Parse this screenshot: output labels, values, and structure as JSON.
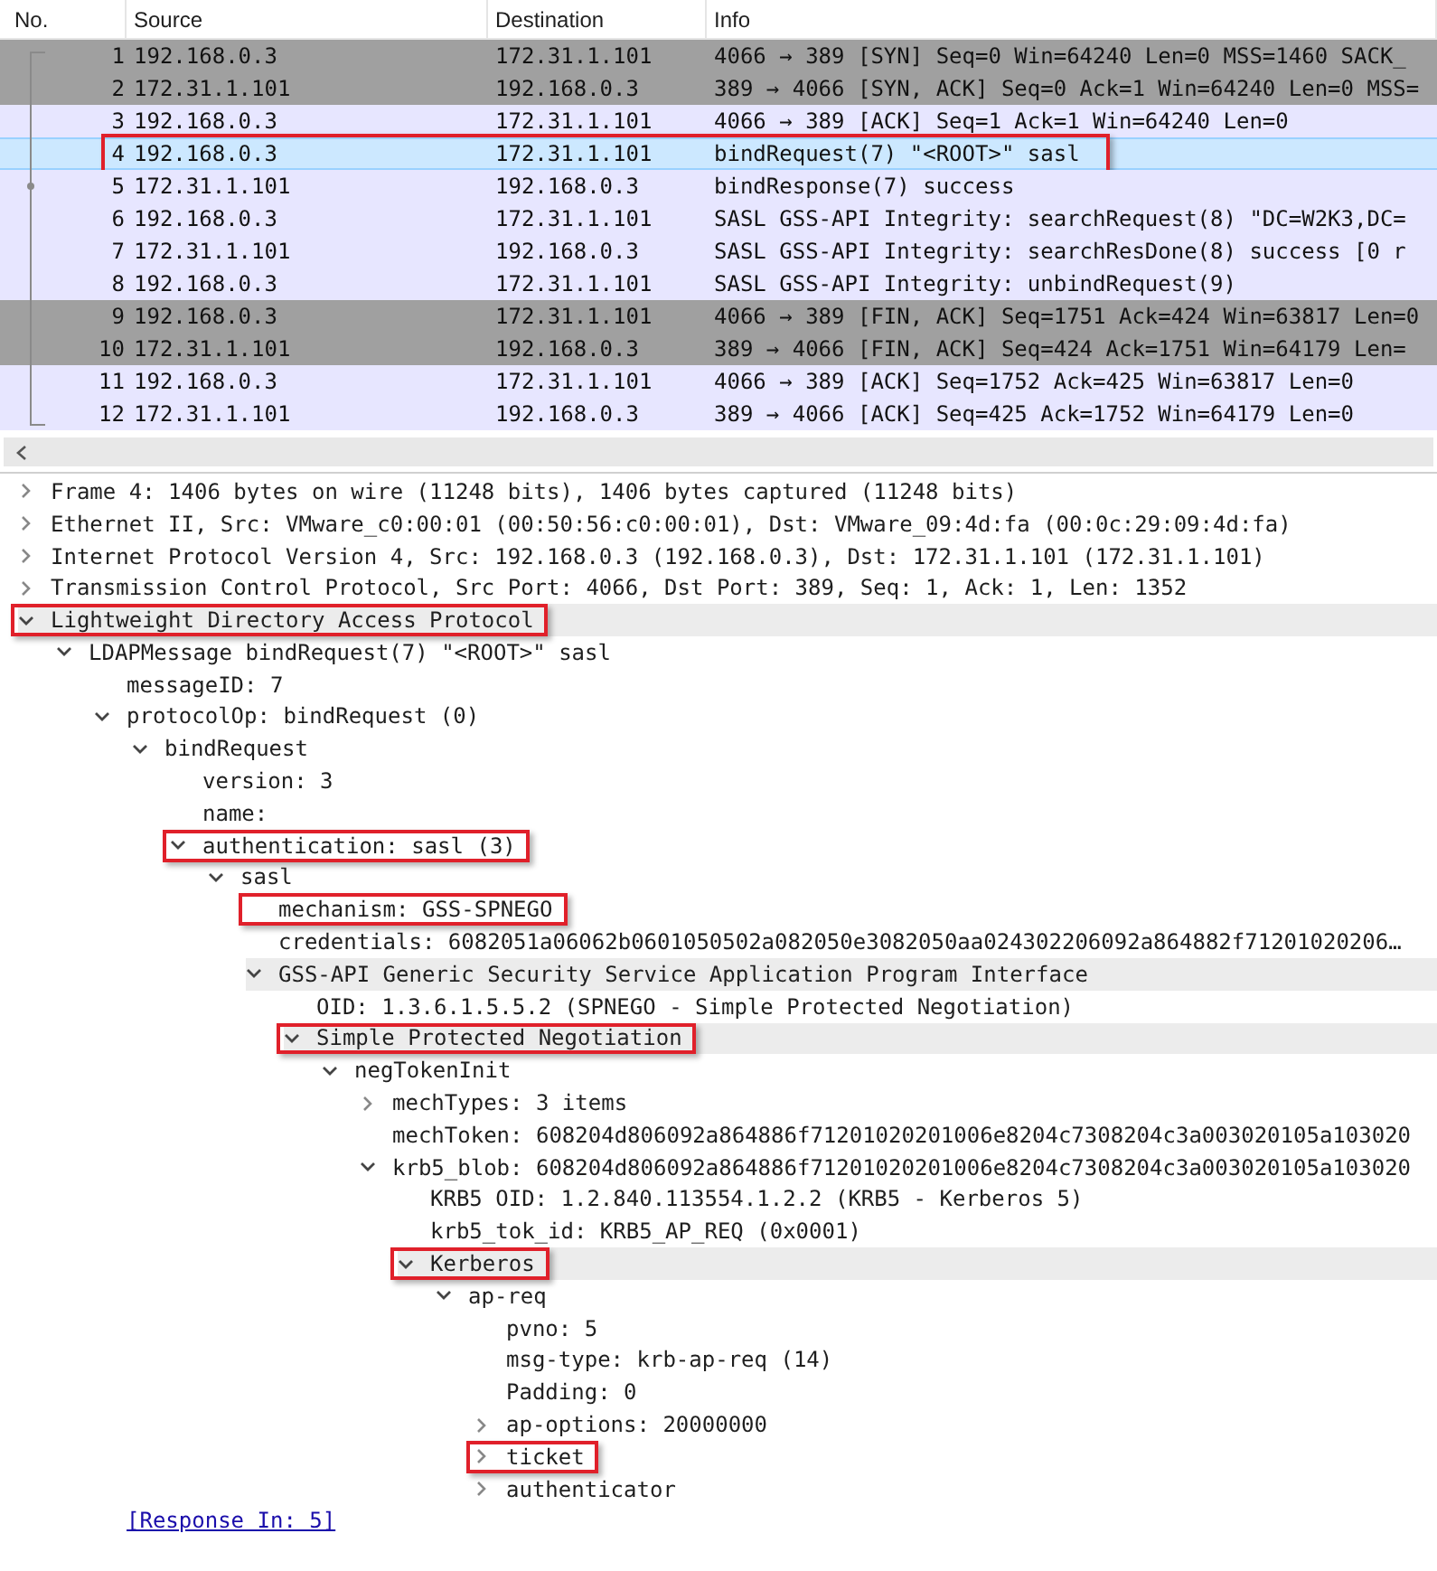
{
  "packet_list": {
    "columns": [
      "No.",
      "Source",
      "Destination",
      "Info"
    ],
    "packets": [
      {
        "no": "1",
        "source": "192.168.0.3",
        "destination": "172.31.1.101",
        "info": "4066 → 389 [SYN] Seq=0 Win=64240 Len=0 MSS=1460 SACK_",
        "color": "#a0a0a0",
        "selected": false,
        "highlighted": false
      },
      {
        "no": "2",
        "source": "172.31.1.101",
        "destination": "192.168.0.3",
        "info": "389 → 4066 [SYN, ACK] Seq=0 Ack=1 Win=64240 Len=0 MSS=",
        "color": "#a0a0a0",
        "selected": false,
        "highlighted": false
      },
      {
        "no": "3",
        "source": "192.168.0.3",
        "destination": "172.31.1.101",
        "info": "4066 → 389 [ACK] Seq=1 Ack=1 Win=64240 Len=0",
        "color": "#e7e6ff",
        "selected": false,
        "highlighted": false
      },
      {
        "no": "4",
        "source": "192.168.0.3",
        "destination": "172.31.1.101",
        "info": "bindRequest(7) \"<ROOT>\" sasl",
        "selected": true,
        "highlighted": true
      },
      {
        "no": "5",
        "source": "172.31.1.101",
        "destination": "192.168.0.3",
        "info": "bindResponse(7) success",
        "color": "#e7e6ff",
        "selected": false,
        "highlighted": false
      },
      {
        "no": "6",
        "source": "192.168.0.3",
        "destination": "172.31.1.101",
        "info": "SASL GSS-API Integrity: searchRequest(8) \"DC=W2K3,DC=",
        "color": "#e7e6ff",
        "selected": false,
        "highlighted": false
      },
      {
        "no": "7",
        "source": "172.31.1.101",
        "destination": "192.168.0.3",
        "info": "SASL GSS-API Integrity: searchResDone(8) success  [0 r",
        "color": "#e7e6ff",
        "selected": false,
        "highlighted": false
      },
      {
        "no": "8",
        "source": "192.168.0.3",
        "destination": "172.31.1.101",
        "info": "SASL GSS-API Integrity: unbindRequest(9)",
        "color": "#e7e6ff",
        "selected": false,
        "highlighted": false
      },
      {
        "no": "9",
        "source": "192.168.0.3",
        "destination": "172.31.1.101",
        "info": "4066 → 389 [FIN, ACK] Seq=1751 Ack=424 Win=63817 Len=0",
        "color": "#a0a0a0",
        "selected": false,
        "highlighted": false
      },
      {
        "no": "10",
        "source": "172.31.1.101",
        "destination": "192.168.0.3",
        "info": "389 → 4066 [FIN, ACK] Seq=424 Ack=1751 Win=64179 Len=",
        "color": "#a0a0a0",
        "selected": false,
        "highlighted": false
      },
      {
        "no": "11",
        "source": "192.168.0.3",
        "destination": "172.31.1.101",
        "info": "4066 → 389 [ACK] Seq=1752 Ack=425 Win=63817 Len=0",
        "color": "#e7e6ff",
        "selected": false,
        "highlighted": false
      },
      {
        "no": "12",
        "source": "172.31.1.101",
        "destination": "192.168.0.3",
        "info": "389 → 4066 [ACK] Seq=425 Ack=1752 Win=64179 Len=0",
        "color": "#e7e6ff",
        "selected": false,
        "highlighted": false
      }
    ]
  },
  "packet_details": [
    {
      "text": "Frame 4: 1406 bytes on wire (11248 bits), 1406 bytes captured (11248 bits)",
      "expanded": false
    },
    {
      "text": "Ethernet II, Src: VMware_c0:00:01 (00:50:56:c0:00:01), Dst: VMware_09:4d:fa (00:0c:29:09:4d:fa)",
      "expanded": false
    },
    {
      "text": "Internet Protocol Version 4, Src: 192.168.0.3 (192.168.0.3), Dst: 172.31.1.101 (172.31.1.101)",
      "expanded": false
    },
    {
      "text": "Transmission Control Protocol, Src Port: 4066, Dst Port: 389, Seq: 1, Ack: 1, Len: 1352",
      "expanded": false
    },
    {
      "text": "Lightweight Directory Access Protocol",
      "expanded": true,
      "highlighted": true,
      "shaded": true,
      "children": [
        {
          "text": "LDAPMessage bindRequest(7) \"<ROOT>\" sasl",
          "expanded": true,
          "children": [
            {
              "text": "messageID: 7"
            },
            {
              "text": "protocolOp: bindRequest (0)",
              "expanded": true,
              "children": [
                {
                  "text": "bindRequest",
                  "expanded": true,
                  "children": [
                    {
                      "text": "version: 3"
                    },
                    {
                      "text": "name:"
                    },
                    {
                      "text": "authentication: sasl (3)",
                      "expanded": true,
                      "highlighted": true,
                      "children": [
                        {
                          "text": "sasl",
                          "expanded": true,
                          "children": [
                            {
                              "text": "mechanism: GSS-SPNEGO",
                              "highlighted": true
                            },
                            {
                              "text": "credentials: 6082051a06062b0601050502a082050e3082050aa024302206092a864882f71201020206…"
                            },
                            {
                              "text": "GSS-API Generic Security Service Application Program Interface",
                              "expanded": true,
                              "shaded": true,
                              "children": [
                                {
                                  "text": "OID: 1.3.6.1.5.5.2 (SPNEGO - Simple Protected Negotiation)"
                                },
                                {
                                  "text": "Simple Protected Negotiation",
                                  "expanded": true,
                                  "highlighted": true,
                                  "shaded": true,
                                  "children": [
                                    {
                                      "text": "negTokenInit",
                                      "expanded": true,
                                      "children": [
                                        {
                                          "text": "mechTypes: 3 items",
                                          "expanded": false
                                        },
                                        {
                                          "text": "mechToken: 608204d806092a864886f71201020201006e8204c7308204c3a003020105a103020"
                                        },
                                        {
                                          "text": "krb5_blob: 608204d806092a864886f71201020201006e8204c7308204c3a003020105a103020",
                                          "expanded": true,
                                          "children": [
                                            {
                                              "text": "KRB5 OID: 1.2.840.113554.1.2.2 (KRB5 - Kerberos 5)"
                                            },
                                            {
                                              "text": "krb5_tok_id: KRB5_AP_REQ (0x0001)"
                                            },
                                            {
                                              "text": "Kerberos",
                                              "expanded": true,
                                              "highlighted": true,
                                              "shaded": true,
                                              "children": [
                                                {
                                                  "text": "ap-req",
                                                  "expanded": true,
                                                  "children": [
                                                    {
                                                      "text": "pvno: 5"
                                                    },
                                                    {
                                                      "text": "msg-type: krb-ap-req (14)"
                                                    },
                                                    {
                                                      "text": "Padding: 0"
                                                    },
                                                    {
                                                      "text": "ap-options: 20000000",
                                                      "expanded": false
                                                    },
                                                    {
                                                      "text": "ticket",
                                                      "expanded": false,
                                                      "highlighted": true
                                                    },
                                                    {
                                                      "text": "authenticator",
                                                      "expanded": false
                                                    }
                                                  ]
                                                }
                                              ]
                                            }
                                          ]
                                        }
                                      ]
                                    }
                                  ]
                                }
                              ]
                            }
                          ]
                        }
                      ]
                    }
                  ]
                }
              ]
            },
            {
              "text": "[Response In: 5]",
              "kind": "link"
            }
          ]
        }
      ]
    }
  ]
}
